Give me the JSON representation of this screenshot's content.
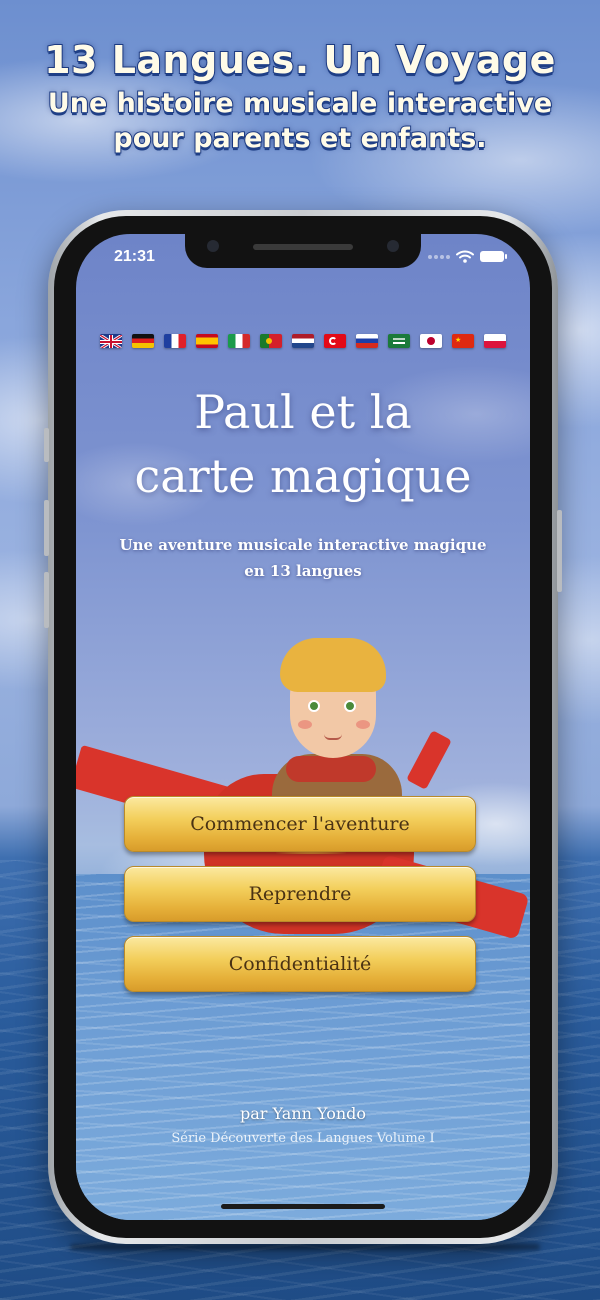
{
  "promo": {
    "line1": "13 Langues. Un Voyage",
    "line2": "Une histoire musicale interactive",
    "line3": "pour parents et enfants."
  },
  "status_bar": {
    "time": "21:31",
    "icons": [
      "signal-dots-icon",
      "wifi-icon",
      "battery-icon"
    ]
  },
  "flags": [
    {
      "name": "uk-flag-icon"
    },
    {
      "name": "germany-flag-icon"
    },
    {
      "name": "france-flag-icon"
    },
    {
      "name": "spain-flag-icon"
    },
    {
      "name": "italy-flag-icon"
    },
    {
      "name": "portugal-flag-icon"
    },
    {
      "name": "netherlands-flag-icon"
    },
    {
      "name": "turkey-flag-icon"
    },
    {
      "name": "russia-flag-icon"
    },
    {
      "name": "saudi-arabia-flag-icon"
    },
    {
      "name": "japan-flag-icon"
    },
    {
      "name": "china-flag-icon"
    },
    {
      "name": "poland-flag-icon"
    }
  ],
  "app": {
    "title_line1": "Paul et la",
    "title_line2": "carte magique",
    "subtitle_line1": "Une aventure musicale interactive magique",
    "subtitle_line2": "en 13 langues",
    "buttons": {
      "start": "Commencer l'aventure",
      "resume": "Reprendre",
      "privacy": "Confidentialité"
    },
    "author": "par Yann Yondo",
    "series": "Série Découverte des Langues Volume I"
  },
  "colors": {
    "button_gold": "#f3cf5c",
    "button_text": "#4a3213",
    "headline_outline": "#1f3f86",
    "plane_red": "#d9342b"
  }
}
